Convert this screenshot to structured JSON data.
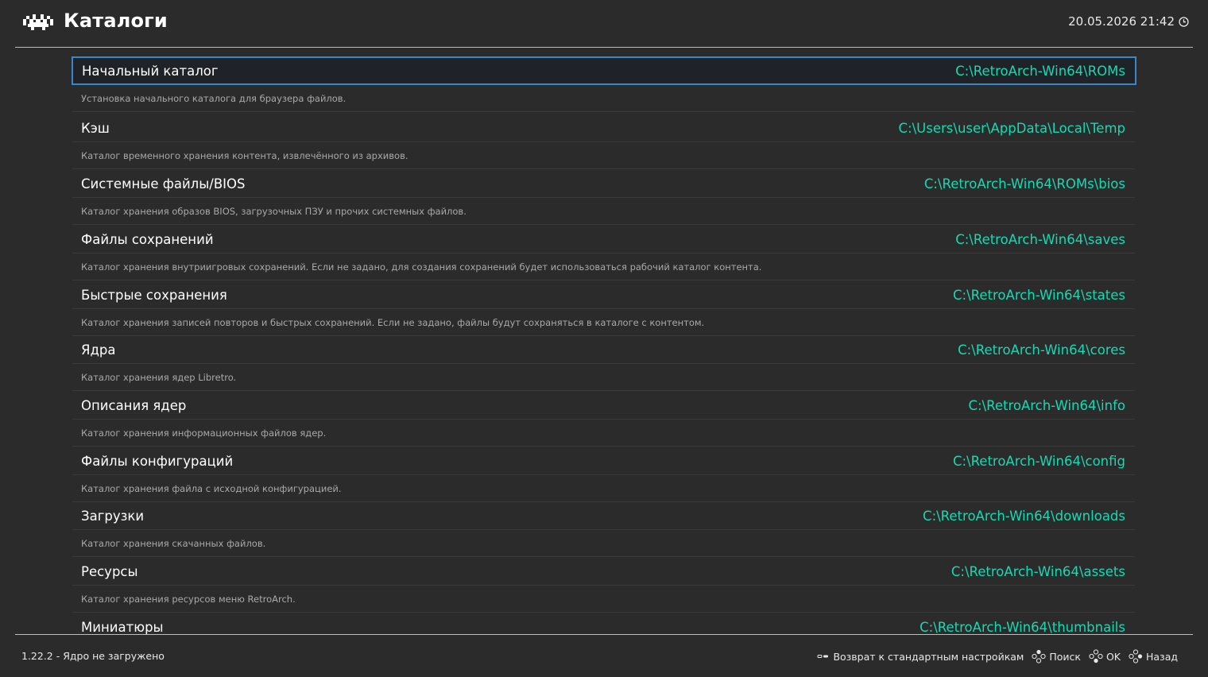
{
  "header": {
    "title": "Каталоги",
    "datetime": "20.05.2026 21:42",
    "logo_icon": "retroarch-invader-icon",
    "clock_icon": "clock-icon"
  },
  "colors": {
    "background": "#2b2b2b",
    "value_accent": "#17d9b2",
    "selection_border": "#3a86c6"
  },
  "items": [
    {
      "label": "Начальный каталог",
      "value": "C:\\RetroArch-Win64\\ROMs",
      "desc": "Установка начального каталога для браузера файлов.",
      "selected": true
    },
    {
      "label": "Кэш",
      "value": "C:\\Users\\user\\AppData\\Local\\Temp",
      "desc": "Каталог временного хранения контента, извлечённого из архивов."
    },
    {
      "label": "Системные файлы/BIOS",
      "value": "C:\\RetroArch-Win64\\ROMs\\bios",
      "desc": "Каталог хранения образов BIOS, загрузочных ПЗУ и прочих системных файлов."
    },
    {
      "label": "Файлы сохранений",
      "value": "C:\\RetroArch-Win64\\saves",
      "desc": "Каталог хранения внутриигровых сохранений. Если не задано, для создания сохранений будет использоваться рабочий каталог контента."
    },
    {
      "label": "Быстрые сохранения",
      "value": "C:\\RetroArch-Win64\\states",
      "desc": "Каталог хранения записей повторов и быстрых сохранений. Если не задано, файлы будут сохраняться в каталоге с контентом."
    },
    {
      "label": "Ядра",
      "value": "C:\\RetroArch-Win64\\cores",
      "desc": "Каталог хранения ядер Libretro."
    },
    {
      "label": "Описания ядер",
      "value": "C:\\RetroArch-Win64\\info",
      "desc": "Каталог хранения информационных файлов ядер."
    },
    {
      "label": "Файлы конфигураций",
      "value": "C:\\RetroArch-Win64\\config",
      "desc": "Каталог хранения файла с исходной конфигурацией."
    },
    {
      "label": "Загрузки",
      "value": "C:\\RetroArch-Win64\\downloads",
      "desc": "Каталог хранения скачанных файлов."
    },
    {
      "label": "Ресурсы",
      "value": "C:\\RetroArch-Win64\\assets",
      "desc": "Каталог хранения ресурсов меню RetroArch."
    },
    {
      "label": "Миниатюры",
      "value": "C:\\RetroArch-Win64\\thumbnails",
      "desc": ""
    }
  ],
  "footer": {
    "status": "1.22.2 - Ядро не загружено",
    "hints": [
      {
        "icon": "select-button-icon",
        "label": "Возврат к стандартным настройкам"
      },
      {
        "icon": "gamepad-north-button-icon",
        "label": "Поиск"
      },
      {
        "icon": "gamepad-south-button-icon",
        "label": "OK"
      },
      {
        "icon": "gamepad-east-button-icon",
        "label": "Назад"
      }
    ]
  }
}
